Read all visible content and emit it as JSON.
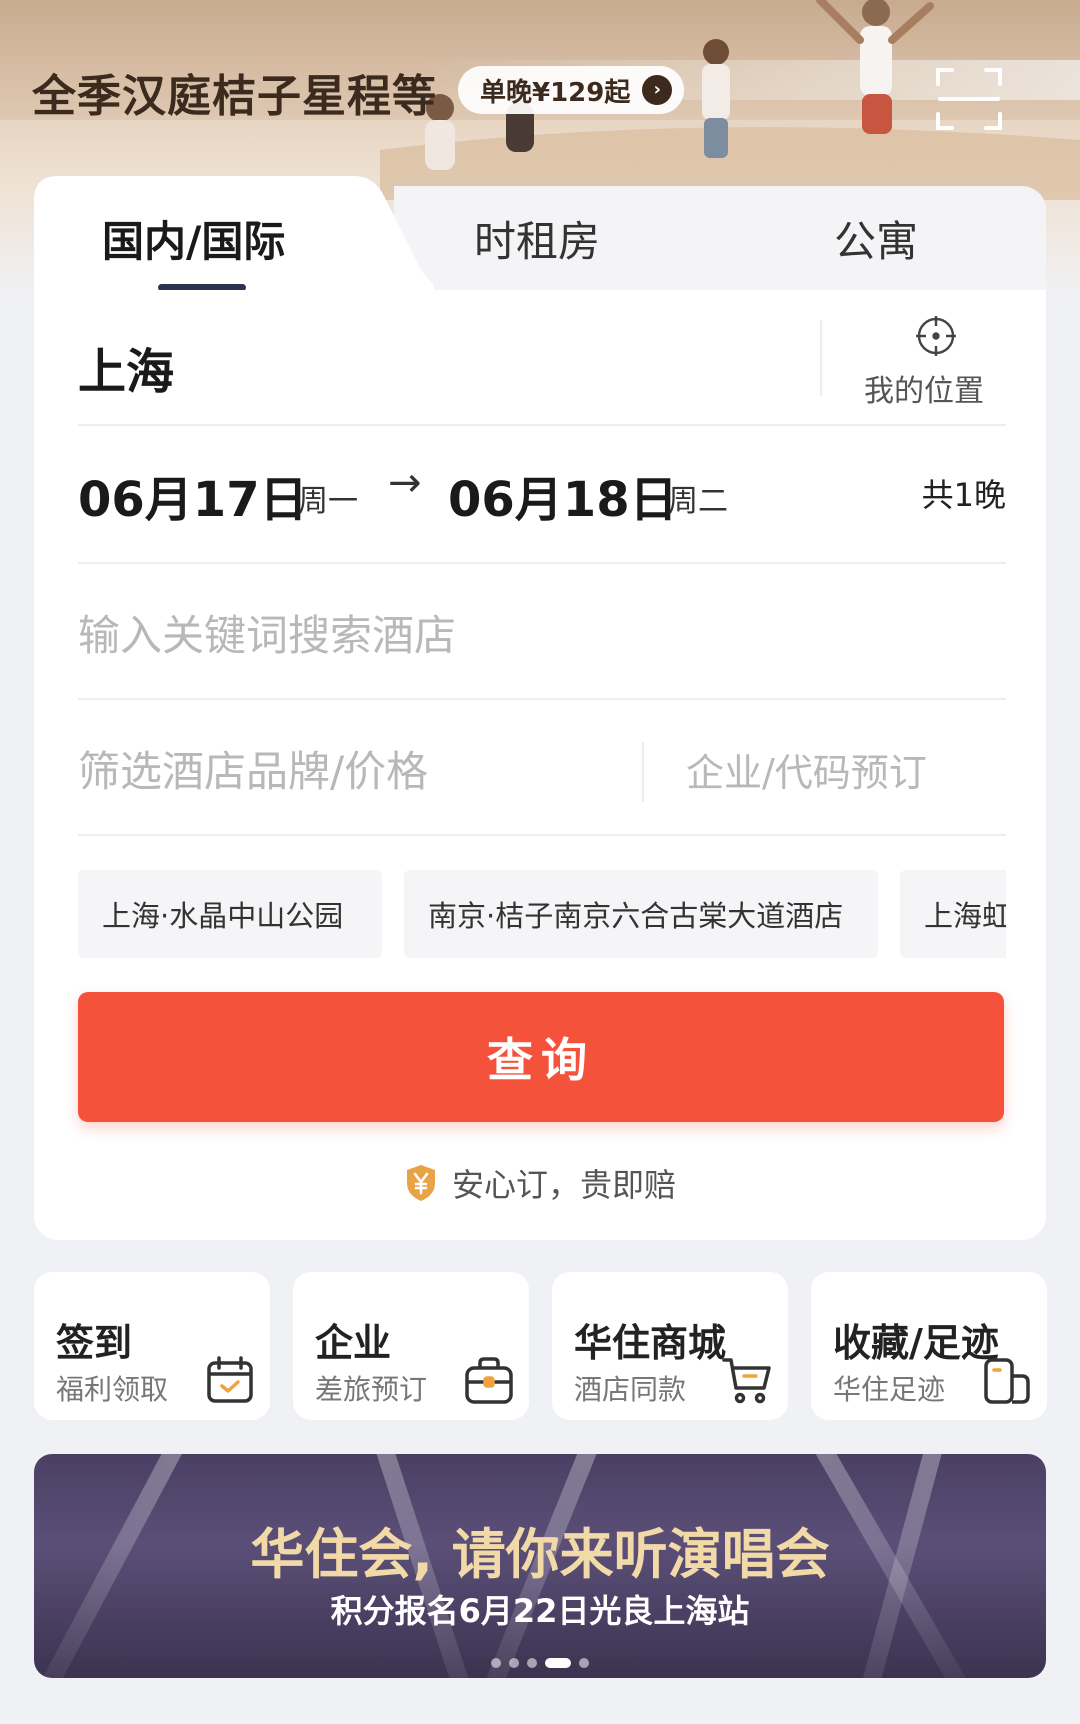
{
  "banner": {
    "title": "全季汉庭桔子星程等",
    "promo": "单晚¥129起"
  },
  "tabs": [
    {
      "label": "国内/国际",
      "active": true
    },
    {
      "label": "时租房",
      "active": false
    },
    {
      "label": "公寓",
      "active": false
    }
  ],
  "search": {
    "city": "上海",
    "location_label": "我的位置",
    "checkin_date": "06月17日",
    "checkin_weekday": "周一",
    "arrow": "→",
    "checkout_date": "06月18日",
    "checkout_weekday": "周二",
    "nights": "共1晚",
    "keyword_placeholder": "输入关键词搜索酒店",
    "filter_placeholder": "筛选酒店品牌/价格",
    "corp_placeholder": "企业/代码预订",
    "history": [
      "上海·水晶中山公园",
      "南京·桔子南京六合古棠大道酒店",
      "上海虹"
    ],
    "submit_label": "查询",
    "assurance": "安心订，贵即赔"
  },
  "quick_entries": [
    {
      "title": "签到",
      "subtitle": "福利领取",
      "icon": "calendar-check-icon"
    },
    {
      "title": "企业",
      "subtitle": "差旅预订",
      "icon": "briefcase-icon"
    },
    {
      "title": "华住商城",
      "subtitle": "酒店同款",
      "icon": "cart-icon"
    },
    {
      "title": "收藏/足迹",
      "subtitle": "华住足迹",
      "icon": "footprint-icon"
    }
  ],
  "promo_banner": {
    "title": "华住会, 请你来听演唱会",
    "subtitle": "积分报名6月22日光良上海站",
    "slide_index": 4,
    "slide_count": 5
  },
  "colors": {
    "primary": "#f5523b",
    "tab_indicator": "#2c3350",
    "banner_text": "#3b2a1d",
    "concert_title": "#f2d9a8"
  }
}
